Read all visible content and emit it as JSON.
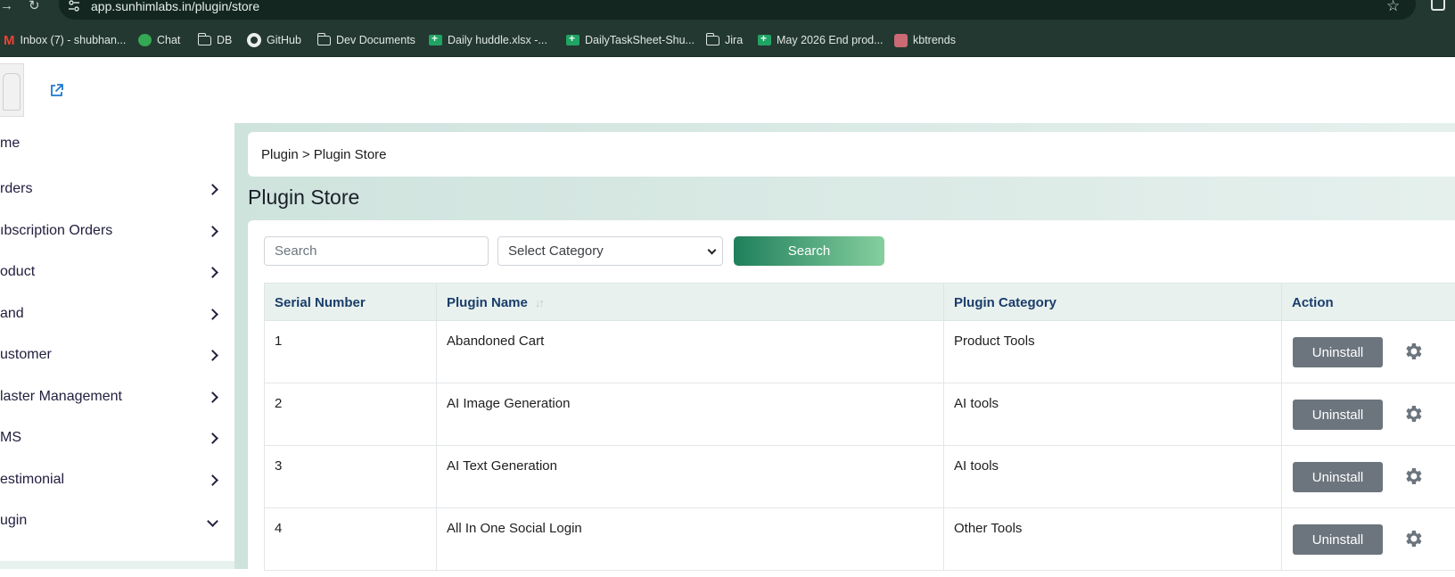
{
  "browser": {
    "url": "app.sunhimlabs.in/plugin/store",
    "bookmarks": [
      {
        "label": "Inbox (7) - shubhan...",
        "icon": "gmail-icon"
      },
      {
        "label": "Chat",
        "icon": "chat-icon"
      },
      {
        "label": "DB",
        "icon": "folder-icon"
      },
      {
        "label": "GitHub",
        "icon": "github-icon"
      },
      {
        "label": "Dev Documents",
        "icon": "folder-icon"
      },
      {
        "label": "Daily huddle.xlsx -...",
        "icon": "sheets-icon"
      },
      {
        "label": "DailyTaskSheet-Shu...",
        "icon": "sheets-icon"
      },
      {
        "label": "Jira",
        "icon": "folder-icon"
      },
      {
        "label": "May 2026 End prod...",
        "icon": "sheets-icon"
      },
      {
        "label": "kbtrends",
        "icon": "kbtrends-icon"
      }
    ]
  },
  "sidebar": {
    "items": [
      {
        "label": "me"
      },
      {
        "label": "rders"
      },
      {
        "label": "ıbscription Orders"
      },
      {
        "label": "oduct"
      },
      {
        "label": "and"
      },
      {
        "label": "ustomer"
      },
      {
        "label": "laster Management"
      },
      {
        "label": "MS"
      },
      {
        "label": "estimonial"
      },
      {
        "label": "ugin"
      }
    ]
  },
  "main": {
    "breadcrumb": "Plugin > Plugin Store",
    "title": "Plugin Store",
    "search_placeholder": "Search",
    "category_select": "Select Category",
    "search_button": "Search",
    "table": {
      "headers": [
        "Serial Number",
        "Plugin Name",
        "Plugin Category",
        "Action"
      ],
      "rows": [
        {
          "serial": "1",
          "name": "Abandoned Cart",
          "category": "Product Tools",
          "action": "Uninstall"
        },
        {
          "serial": "2",
          "name": "AI Image Generation",
          "category": "AI tools",
          "action": "Uninstall"
        },
        {
          "serial": "3",
          "name": "AI Text Generation",
          "category": "AI tools",
          "action": "Uninstall"
        },
        {
          "serial": "4",
          "name": "All In One Social Login",
          "category": "Other Tools",
          "action": "Uninstall"
        }
      ]
    }
  },
  "colors": {
    "chrome_bg": "#233831",
    "accent_green": "#1f7f5c",
    "header_text": "#1a3d6b",
    "uninstall_bg": "#6c757d"
  }
}
